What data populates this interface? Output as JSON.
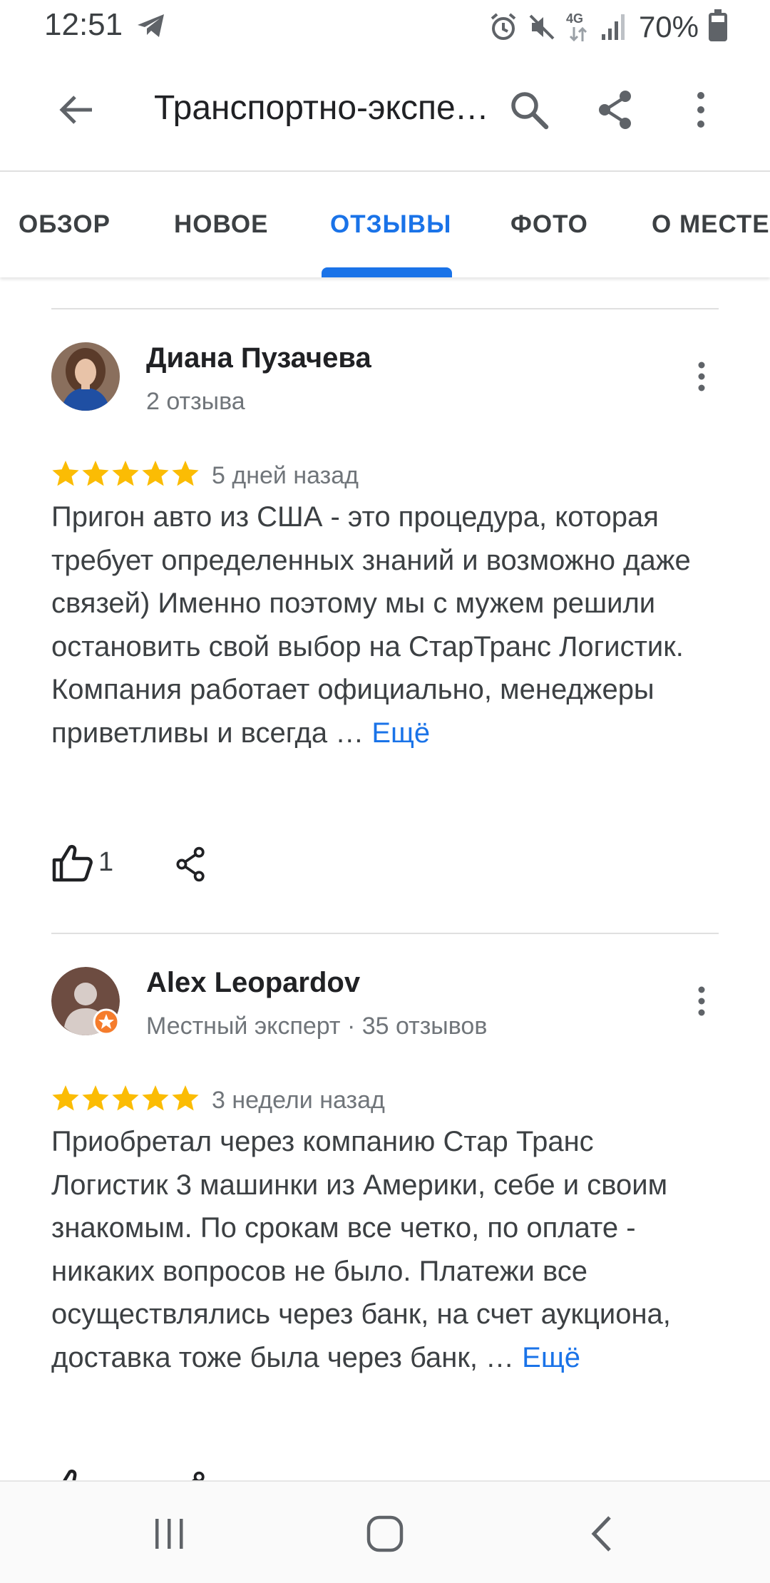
{
  "status_bar": {
    "time": "12:51",
    "network_label": "4G",
    "battery_percent": "70%",
    "battery_level": 0.7,
    "icons": [
      "telegram-icon",
      "alarm-icon",
      "mute-icon",
      "network-4g-icon",
      "signal-icon",
      "battery-icon"
    ]
  },
  "app_bar": {
    "title": "Транспортно-экспедиционная компания СтарТранс Логистик",
    "icons": [
      "back-arrow-icon",
      "search-icon",
      "share-icon",
      "more-vert-icon"
    ]
  },
  "tabs": [
    {
      "label": "ОБЗОР",
      "active": false
    },
    {
      "label": "НОВОЕ",
      "active": false
    },
    {
      "label": "ОТЗЫВЫ",
      "active": true
    },
    {
      "label": "ФОТО",
      "active": false
    },
    {
      "label": "О МЕСТЕ",
      "active": false
    }
  ],
  "reviews": [
    {
      "author": "Диана Пузачева",
      "meta": "2 отзыва",
      "rating": 5,
      "date": "5 дней назад",
      "text": "Пригон авто из США - это процедура, которая требует определенных знаний и возможно даже связей) Именно поэтому мы с мужем решили остановить свой выбор на СтарТранс Логистик. Компания работает официально, менеджеры приветливы и всегда …",
      "more_label": "Ещё",
      "likes": "1"
    },
    {
      "author": "Alex Leopardov",
      "meta": "Местный эксперт · 35 отзывов",
      "rating": 5,
      "date": "3 недели назад",
      "text": "Приобретал через компанию Стар Транс Логистик 3 машинки из Америки, себе и своим знакомым. По срокам все четко, по оплате - никаких вопросов не было. Платежи все осуществлялись через банк, на счет аукциона, доставка тоже была через банк, …",
      "more_label": "Ещё",
      "likes": ""
    }
  ],
  "colors": {
    "accent": "#1a73e8",
    "star": "#fbbc04",
    "text_primary": "#202124",
    "text_secondary": "#70757a",
    "local_guide_badge": "#f57c2c"
  },
  "nav_bar": {
    "icons": [
      "recent-apps-icon",
      "home-icon",
      "back-icon"
    ]
  }
}
